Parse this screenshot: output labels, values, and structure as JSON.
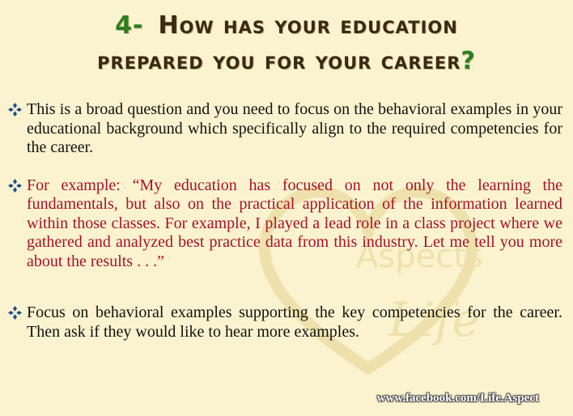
{
  "title": {
    "number": "4-",
    "line1": "How has your education",
    "line2": "prepared you for your career",
    "qmark": "?"
  },
  "bullets": [
    {
      "text": "This is a broad question and you need to focus on the behavioral examples in your educational background which specifically align to the required competencies for the career."
    },
    {
      "text": "For example: “My education has focused on not only the learning the fundamentals, but also on the practical application of the information learned within those classes. For example, I played a lead role in a class project where we gathered and analyzed best practice data from this industry. Let me tell you more about the results . . .”",
      "color": "#a8102a"
    },
    {
      "text": "Focus on behavioral examples supporting the key competencies for the career. Then ask if they would like to hear more examples."
    }
  ],
  "watermark": {
    "logo_text": "Aspects Life",
    "url": "www.facebook.com/Life.Aspect"
  },
  "colors": {
    "background": "#fbf3cf",
    "accent_green": "#2e7d1f",
    "example_red": "#a8102a",
    "bullet_icon": "#1f4e8c"
  }
}
